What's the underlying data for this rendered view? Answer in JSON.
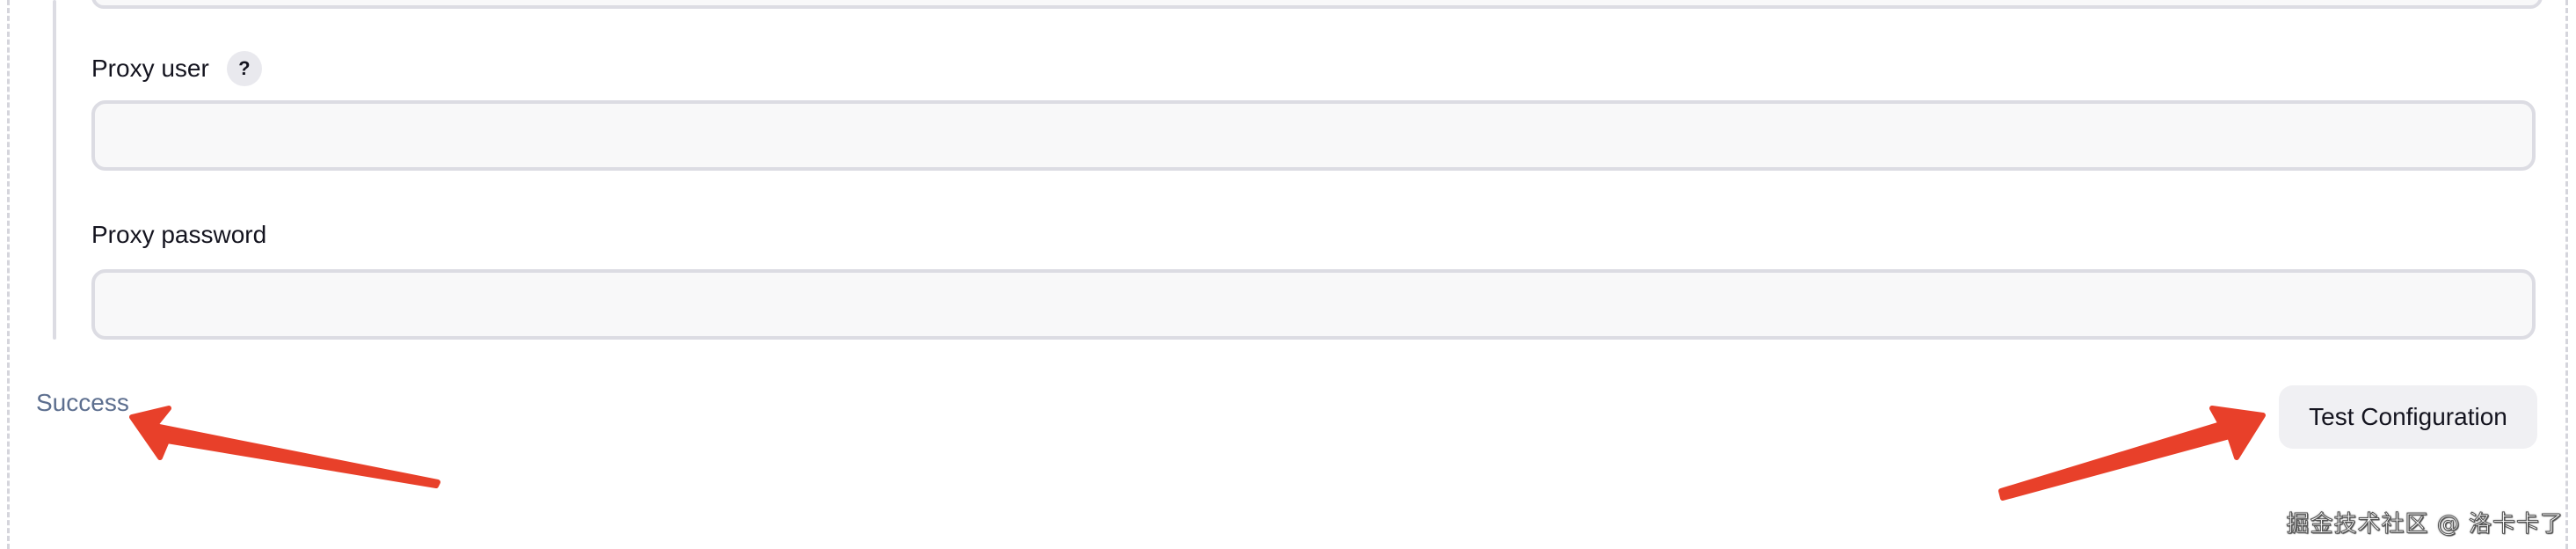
{
  "form": {
    "proxy_user": {
      "label": "Proxy user",
      "help": "?",
      "value": ""
    },
    "proxy_password": {
      "label": "Proxy password",
      "value": ""
    }
  },
  "status": {
    "text": "Success"
  },
  "actions": {
    "test_configuration_label": "Test Configuration"
  },
  "watermark": {
    "text": "掘金技术社区 @ 洛卡卡了"
  },
  "colors": {
    "arrow": "#e8402a",
    "status_text": "#5d6f8f",
    "field_border": "#dcdce3",
    "field_background": "#f8f8f9",
    "button_background": "#f0f0f3"
  }
}
